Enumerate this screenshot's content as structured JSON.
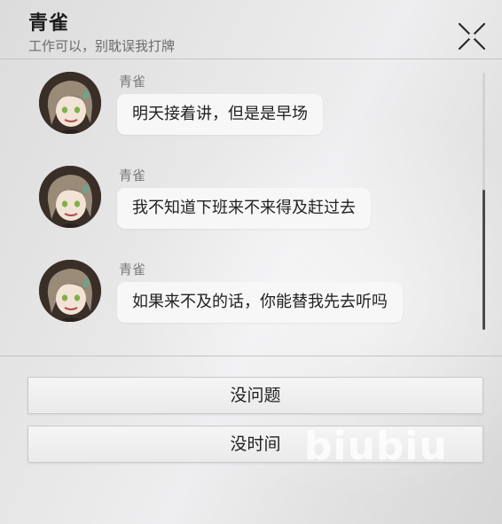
{
  "header": {
    "title": "青雀",
    "subtitle": "工作可以，别耽误我打牌"
  },
  "icons": {
    "close": "close-icon",
    "avatar": "character-avatar"
  },
  "messages": [
    {
      "sender": "青雀",
      "text": "明天接着讲，但是是早场"
    },
    {
      "sender": "青雀",
      "text": "我不知道下班来不来得及赶过去"
    },
    {
      "sender": "青雀",
      "text": "如果来不及的话，你能替我先去听吗"
    }
  ],
  "scrollbar": {
    "position_fraction": 0.46,
    "thumb_fraction": 0.54
  },
  "options": [
    {
      "label": "没问题"
    },
    {
      "label": "没时间"
    }
  ],
  "watermark": "biubiu",
  "colors": {
    "avatar_hair": "#9a8a78",
    "avatar_eyes": "#7fb04a",
    "avatar_bg": "#3a2e28",
    "bubble_bg": "#f7f7f7"
  }
}
